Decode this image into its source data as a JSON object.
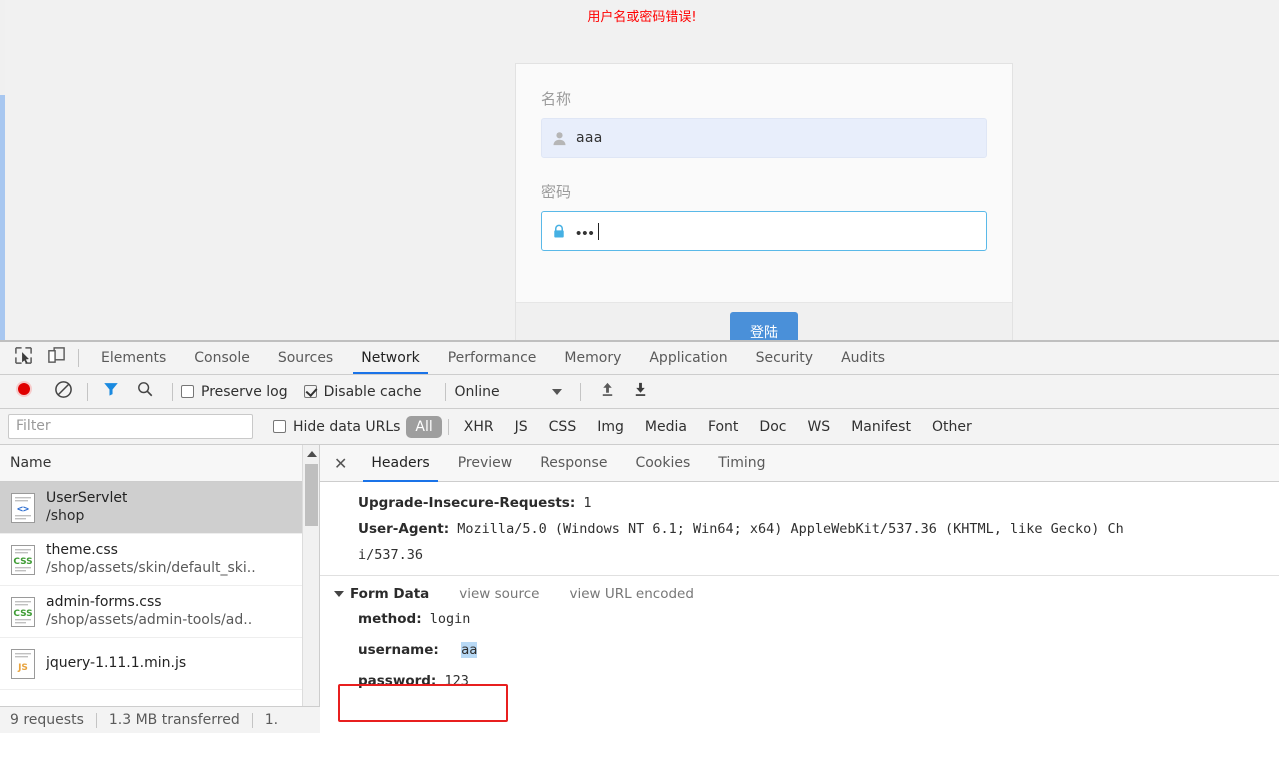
{
  "page": {
    "error_message": "用户名或密码错误!",
    "form": {
      "username_label": "名称",
      "username_value": "aaa",
      "password_label": "密码",
      "password_value": "•••",
      "submit_label": "登陆"
    }
  },
  "devtools": {
    "tabs": [
      {
        "label": "Elements",
        "active": false
      },
      {
        "label": "Console",
        "active": false
      },
      {
        "label": "Sources",
        "active": false
      },
      {
        "label": "Network",
        "active": true
      },
      {
        "label": "Performance",
        "active": false
      },
      {
        "label": "Memory",
        "active": false
      },
      {
        "label": "Application",
        "active": false
      },
      {
        "label": "Security",
        "active": false
      },
      {
        "label": "Audits",
        "active": false
      }
    ],
    "toolbar": {
      "preserve_log_label": "Preserve log",
      "preserve_log_checked": false,
      "disable_cache_label": "Disable cache",
      "disable_cache_checked": true,
      "throttling_value": "Online"
    },
    "filterbar": {
      "filter_placeholder": "Filter",
      "hide_data_urls_label": "Hide data URLs",
      "hide_data_urls_checked": false,
      "types": [
        "All",
        "XHR",
        "JS",
        "CSS",
        "Img",
        "Media",
        "Font",
        "Doc",
        "WS",
        "Manifest",
        "Other"
      ],
      "types_selected": "All"
    },
    "requests": {
      "column_header": "Name",
      "rows": [
        {
          "name": "UserServlet",
          "path": "/shop",
          "kind": "doc",
          "selected": true
        },
        {
          "name": "theme.css",
          "path": "/shop/assets/skin/default_ski..",
          "kind": "css",
          "selected": false
        },
        {
          "name": "admin-forms.css",
          "path": "/shop/assets/admin-tools/ad..",
          "kind": "css",
          "selected": false
        },
        {
          "name": "jquery-1.11.1.min.js",
          "path": "",
          "kind": "js",
          "selected": false
        }
      ]
    },
    "detail": {
      "tabs": [
        {
          "label": "Headers",
          "active": true
        },
        {
          "label": "Preview",
          "active": false
        },
        {
          "label": "Response",
          "active": false
        },
        {
          "label": "Cookies",
          "active": false
        },
        {
          "label": "Timing",
          "active": false
        }
      ],
      "headers": [
        {
          "key": "Upgrade-Insecure-Requests:",
          "value": "1"
        },
        {
          "key": "User-Agent:",
          "value": "Mozilla/5.0 (Windows NT 6.1; Win64; x64) AppleWebKit/537.36 (KHTML, like Gecko) Ch"
        },
        {
          "key": "",
          "value": "i/537.36"
        }
      ],
      "form_data": {
        "section_title": "Form Data",
        "view_source_label": "view source",
        "view_url_encoded_label": "view URL encoded",
        "entries": [
          {
            "key": "method:",
            "value": "login",
            "highlighted": false
          },
          {
            "key": "username:",
            "value": "aa",
            "highlighted": true
          },
          {
            "key": "password:",
            "value": "123",
            "highlighted": false
          }
        ]
      }
    },
    "status": {
      "requests": "9 requests",
      "transferred": "1.3 MB transferred",
      "finish": "1."
    }
  },
  "colors": {
    "accent_blue": "#1a73e8",
    "error_red": "#ff0000",
    "button_blue": "#4a90d9",
    "annotation_red": "#e81f1f",
    "selection_blue": "#b8d9f5"
  }
}
